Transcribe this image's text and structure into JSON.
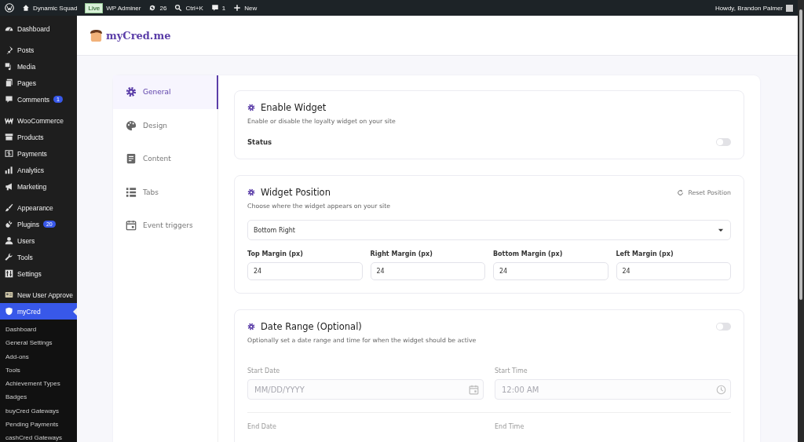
{
  "admin_bar": {
    "items": [
      {
        "kind": "wp"
      },
      {
        "kind": "home",
        "label": "Dynamic Squad"
      },
      {
        "kind": "badge",
        "label": "Live"
      },
      {
        "kind": "text",
        "label": "WP Adminer"
      },
      {
        "kind": "updates",
        "label": "26"
      },
      {
        "kind": "search",
        "label": "Ctrl+K"
      },
      {
        "kind": "comments",
        "label": "1"
      },
      {
        "kind": "new",
        "label": "New"
      }
    ],
    "greeting": "Howdy, Brandon Palmer"
  },
  "sidebar": {
    "groups": [
      {
        "items": [
          {
            "label": "Dashboard",
            "selected": false
          }
        ]
      },
      {
        "items": [
          {
            "label": "Posts",
            "selected": false
          },
          {
            "label": "Media",
            "selected": false
          },
          {
            "label": "Pages",
            "selected": false
          },
          {
            "label": "Comments",
            "badge": "1",
            "selected": false
          }
        ]
      },
      {
        "items": [
          {
            "label": "WooCommerce",
            "selected": false
          },
          {
            "label": "Products",
            "selected": false
          },
          {
            "label": "Payments",
            "selected": false
          },
          {
            "label": "Analytics",
            "selected": false
          },
          {
            "label": "Marketing",
            "selected": false
          }
        ]
      },
      {
        "items": [
          {
            "label": "Appearance",
            "selected": false
          },
          {
            "label": "Plugins",
            "badge": "20",
            "selected": false
          },
          {
            "label": "Users",
            "selected": false
          },
          {
            "label": "Tools",
            "selected": false
          },
          {
            "label": "Settings",
            "selected": false
          }
        ]
      },
      {
        "items": [
          {
            "label": "New User Approve",
            "selected": false
          },
          {
            "label": "myCred",
            "selected": true
          }
        ]
      }
    ],
    "submenu": [
      {
        "label": "Dashboard",
        "selected": false
      },
      {
        "label": "General Settings",
        "selected": false
      },
      {
        "label": "Add-ons",
        "selected": false
      },
      {
        "label": "Tools",
        "selected": false
      },
      {
        "label": "Achievement Types",
        "selected": false
      },
      {
        "label": "Badges",
        "selected": false
      },
      {
        "label": "buyCred Gateways",
        "selected": false
      },
      {
        "label": "Pending Payments",
        "selected": false
      },
      {
        "label": "cashCred Gateways",
        "selected": false
      }
    ]
  },
  "header": {
    "logo_text": "myCred.me"
  },
  "settings_nav": [
    {
      "label": "General",
      "selected": true
    },
    {
      "label": "Design",
      "selected": false
    },
    {
      "label": "Content",
      "selected": false
    },
    {
      "label": "Tabs",
      "selected": false
    },
    {
      "label": "Event triggers",
      "selected": false
    }
  ],
  "sections": [
    {
      "kind": "toggle",
      "title": "Enable Widget",
      "description": "Enable or disable the loyalty widget on your site",
      "status_label": "Status",
      "on": false
    },
    {
      "kind": "position",
      "title": "Widget Position",
      "description": "Choose where the widget appears on your site",
      "action": "Reset Position",
      "select": {
        "value": "Bottom Right"
      },
      "fields": [
        {
          "label": "Top Margin (px)",
          "value": "24"
        },
        {
          "label": "Right Margin (px)",
          "value": "24"
        },
        {
          "label": "Bottom Margin (px)",
          "value": "24"
        },
        {
          "label": "Left Margin (px)",
          "value": "24"
        }
      ]
    },
    {
      "kind": "date_range",
      "title": "Date Range (Optional)",
      "description": "Optionally set a date range and time for when the widget should be active",
      "on": false,
      "fields": [
        {
          "label": "Start Date",
          "placeholder": "MM/DD/YYYY"
        },
        {
          "label": "Start Time",
          "placeholder": "12:00 AM"
        }
      ],
      "more_labels": [
        "End Date",
        "End Time"
      ]
    }
  ]
}
